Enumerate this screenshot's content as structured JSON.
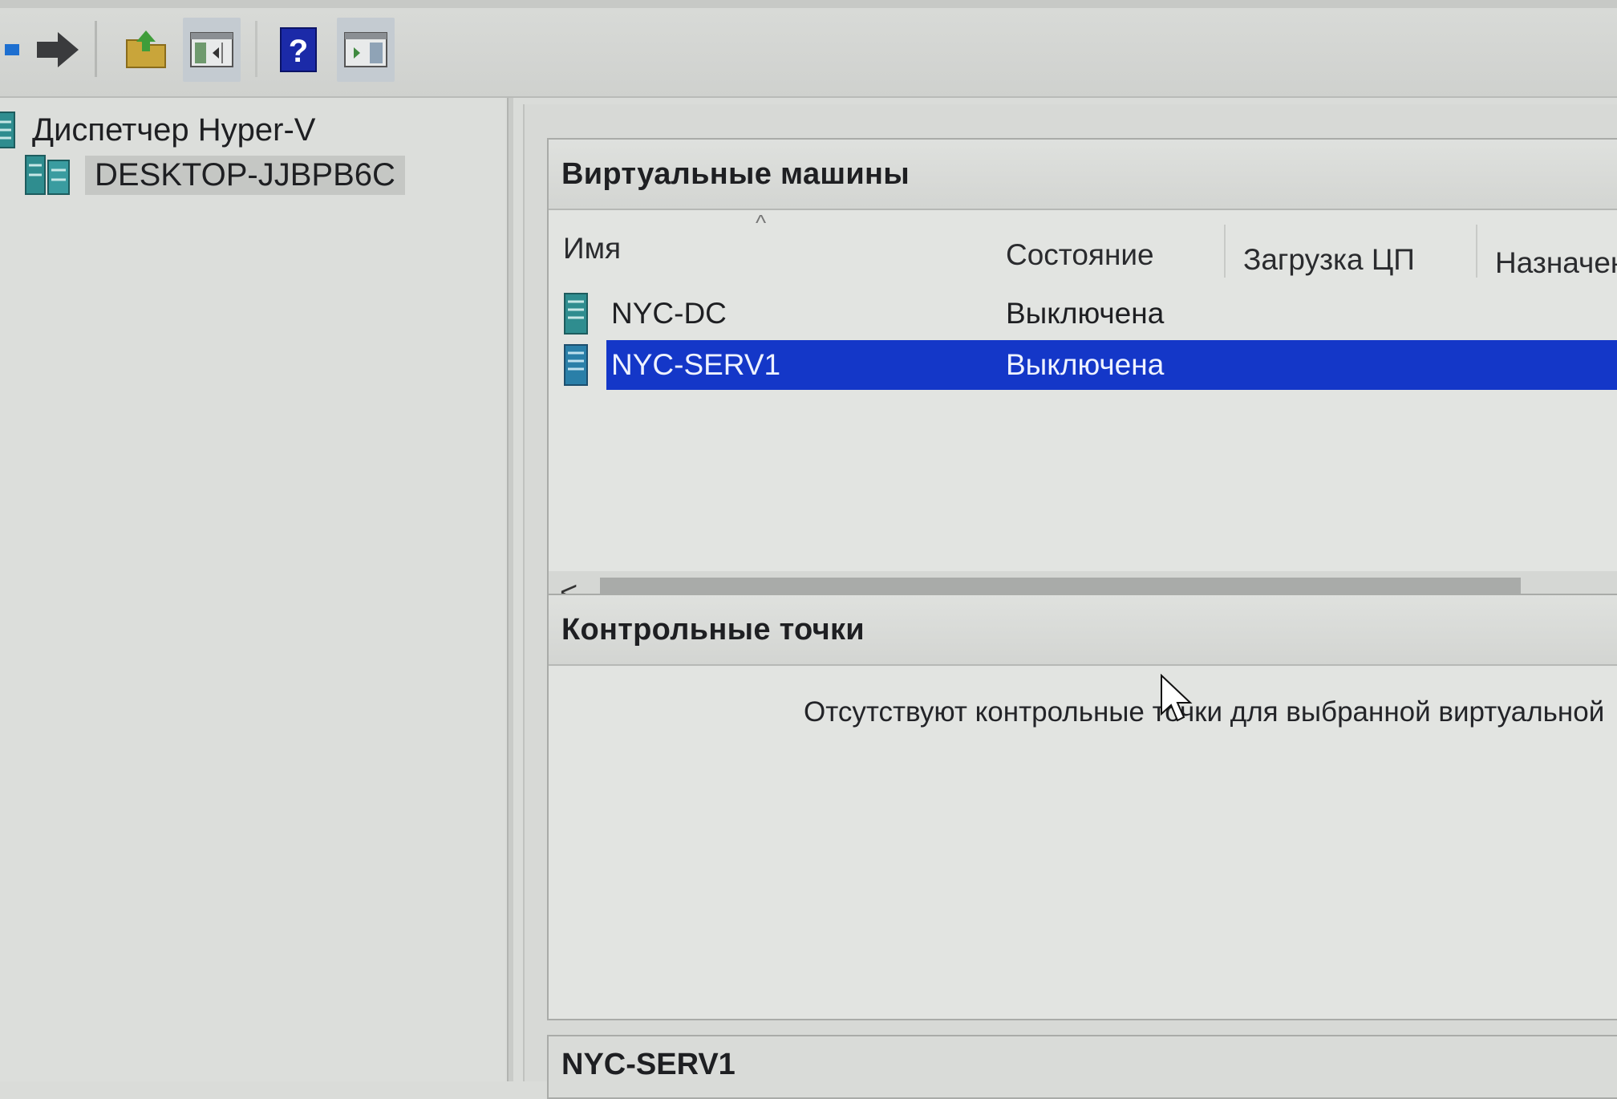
{
  "toolbar": {
    "buttons": [
      {
        "icon": "back-arrow-icon"
      },
      {
        "icon": "forward-arrow-icon"
      },
      {
        "icon": "up-folder-icon"
      },
      {
        "icon": "show-hide-console-tree-icon"
      },
      {
        "icon": "help-icon"
      },
      {
        "icon": "show-hide-action-pane-icon"
      }
    ]
  },
  "tree": {
    "root_label": "Диспетчер Hyper-V",
    "server_label": "DESKTOP-JJBPB6C"
  },
  "vm_panel": {
    "title": "Виртуальные машины",
    "columns": {
      "name": "Имя",
      "state": "Состояние",
      "cpu": "Загрузка ЦП",
      "assigned": "Назначенн"
    },
    "rows": [
      {
        "name": "NYC-DC",
        "state": "Выключена",
        "selected": false
      },
      {
        "name": "NYC-SERV1",
        "state": "Выключена",
        "selected": true
      }
    ],
    "scroll_left_glyph": "<"
  },
  "checkpoints_panel": {
    "title": "Контрольные точки",
    "empty_message": "Отсутствуют контрольные точки для выбранной виртуальной"
  },
  "details_panel": {
    "title": "NYC-SERV1"
  },
  "colors": {
    "selection": "#1437c8",
    "vm_icon": "#2b8f9a"
  }
}
